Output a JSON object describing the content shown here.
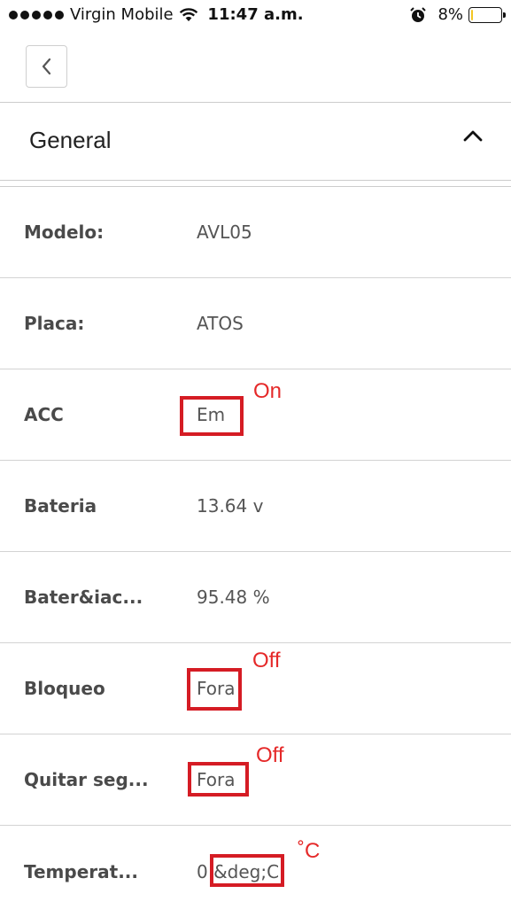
{
  "status_bar": {
    "carrier": "Virgin Mobile",
    "time": "11:47 a.m.",
    "battery": "8%",
    "battery_level": 0.08,
    "battery_color": "#f3c623"
  },
  "nav": {
    "back_icon": "chevron-left-icon"
  },
  "section": {
    "title": "General",
    "toggle_icon": "chevron-up-icon"
  },
  "rows": [
    {
      "label": "Modelo:",
      "value": "AVL05"
    },
    {
      "label": "Placa:",
      "value": "ATOS"
    },
    {
      "label": "ACC",
      "value": "Em"
    },
    {
      "label": "Bateria",
      "value": "13.64 v"
    },
    {
      "label": "Bater&iac...",
      "value": "95.48 %"
    },
    {
      "label": "Bloqueo",
      "value": "Fora"
    },
    {
      "label": "Quitar seg...",
      "value": "Fora"
    },
    {
      "label": "Temperat...",
      "value": "0 &deg;C"
    }
  ],
  "annotations": {
    "acc_note": "On",
    "bloqueo_note": "Off",
    "quitar_note": "Off",
    "temp_note": "˚C",
    "color": "#d51c24"
  }
}
